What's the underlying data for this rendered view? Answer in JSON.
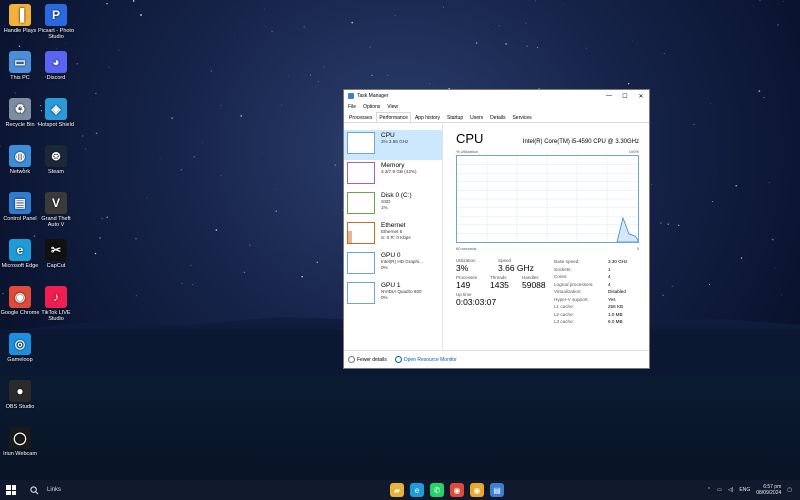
{
  "desktop": {
    "icons": [
      {
        "label": "Handle Plays",
        "color": "#f0b23a",
        "glyph": "▐"
      },
      {
        "label": "This PC",
        "color": "#4a8fd8",
        "glyph": "▭"
      },
      {
        "label": "Recycle Bin",
        "color": "#7d8da0",
        "glyph": "♻"
      },
      {
        "label": "Network",
        "color": "#3a8fd8",
        "glyph": "◍"
      },
      {
        "label": "Control Panel",
        "color": "#2e7bd0",
        "glyph": "▤"
      },
      {
        "label": "Microsoft Edge",
        "color": "#1d9cd8",
        "glyph": "e"
      },
      {
        "label": "Google Chrome",
        "color": "#e04a3a",
        "glyph": "◉"
      },
      {
        "label": "Gameloop",
        "color": "#1d8fe0",
        "glyph": "◎"
      },
      {
        "label": "OBS Studio",
        "color": "#2a2a2a",
        "glyph": "●"
      },
      {
        "label": "Iriun Webcam",
        "color": "#1a1a1a",
        "glyph": "◯"
      }
    ],
    "icons2": [
      {
        "label": "Picsart - Photo Studio",
        "color": "#2a6ae0",
        "glyph": "P"
      },
      {
        "label": "Discord",
        "color": "#5865f2",
        "glyph": "◕"
      },
      {
        "label": "Hotspot Shield",
        "color": "#2a9ad8",
        "glyph": "◈"
      },
      {
        "label": "Steam",
        "color": "#1b2838",
        "glyph": "⊛"
      },
      {
        "label": "Grand Theft Auto V",
        "color": "#3a3a3a",
        "glyph": "V"
      },
      {
        "label": "CapCut",
        "color": "#111111",
        "glyph": "✂"
      },
      {
        "label": "TikTok LIVE Studio",
        "color": "#ee1d52",
        "glyph": "♪"
      }
    ]
  },
  "taskbar": {
    "search": "Links",
    "apps": [
      {
        "name": "file-explorer-icon",
        "color": "#e8b53a",
        "glyph": "▰"
      },
      {
        "name": "edge-icon",
        "color": "#1d9cd8",
        "glyph": "e"
      },
      {
        "name": "whatsapp-icon",
        "color": "#25d366",
        "glyph": "✆"
      },
      {
        "name": "chrome-icon",
        "color": "#e04a3a",
        "glyph": "◉"
      },
      {
        "name": "chrome-alt-icon",
        "color": "#e9a92b",
        "glyph": "◉"
      },
      {
        "name": "task-manager-icon",
        "color": "#3d7fd1",
        "glyph": "▤"
      }
    ],
    "tray_lang": "ENG",
    "time": "6:57 pm",
    "date": "08/09/2024"
  },
  "taskmanager": {
    "title": "Task Manager",
    "controls": {
      "minimize": "—",
      "maximize": "☐",
      "close": "✕"
    },
    "menu": [
      "File",
      "Options",
      "View"
    ],
    "tabs": [
      "Processes",
      "Performance",
      "App history",
      "Startup",
      "Users",
      "Details",
      "Services"
    ],
    "active_tab": "Performance",
    "sidebar": [
      {
        "title": "CPU",
        "sub1": "3% 3.66 GHz",
        "sub2": "",
        "color": "#6aa7d8"
      },
      {
        "title": "Memory",
        "sub1": "3.3/7.9 GB (42%)",
        "sub2": "",
        "color": "#a15fc0"
      },
      {
        "title": "Disk 0 (C:)",
        "sub1": "SSD",
        "sub2": "1%",
        "color": "#6aa84f"
      },
      {
        "title": "Ethernet",
        "sub1": "Ethernet 6",
        "sub2": "S: 0 R: 0 Kbps",
        "color": "#c76d22"
      },
      {
        "title": "GPU 0",
        "sub1": "Intel(R) HD Graphi...",
        "sub2": "0%",
        "color": "#6aa7d8"
      },
      {
        "title": "GPU 1",
        "sub1": "NVIDIA Quadro 600",
        "sub2": "0%",
        "color": "#6aa7d8"
      }
    ],
    "main": {
      "heading": "CPU",
      "model": "Intel(R) Core(TM) i5-4590 CPU @ 3.30GHz",
      "graph_label_left": "% Utilization",
      "graph_label_right": "100%",
      "axis_left": "60 seconds",
      "axis_right": "0",
      "utilization_label": "Utilization",
      "utilization": "3%",
      "speed_label": "Speed",
      "speed": "3.66 GHz",
      "processes_label": "Processes",
      "processes": "149",
      "threads_label": "Threads",
      "threads": "1435",
      "handles_label": "Handles",
      "handles": "59088",
      "uptime_label": "Up time",
      "uptime": "0:03:03:07",
      "specs": [
        {
          "k": "Base speed:",
          "v": "3.30 GHz"
        },
        {
          "k": "Sockets:",
          "v": "1"
        },
        {
          "k": "Cores:",
          "v": "4"
        },
        {
          "k": "Logical processors:",
          "v": "4"
        },
        {
          "k": "Virtualization:",
          "v": "Disabled"
        },
        {
          "k": "Hyper-V support:",
          "v": "Yes"
        },
        {
          "k": "L1 cache:",
          "v": "256 KB"
        },
        {
          "k": "L2 cache:",
          "v": "1.0 MB"
        },
        {
          "k": "L3 cache:",
          "v": "6.0 MB"
        }
      ]
    },
    "footer": {
      "fewer": "Fewer details",
      "monitor": "Open Resource Monitor"
    }
  }
}
